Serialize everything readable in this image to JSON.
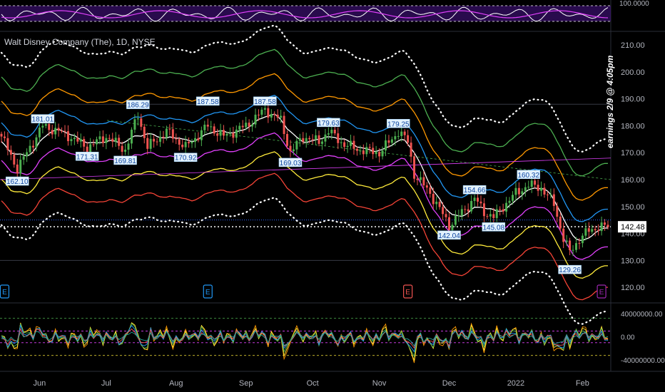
{
  "header": {
    "title": "Walt Disney Company (The), 1D, NYSE",
    "side_note": "earnings 2/9 @ 4:05pm"
  },
  "colors": {
    "background": "#000000",
    "up": "#26a69a",
    "up_bright": "#4caf50",
    "down": "#ef5350",
    "grid": "#1a1a1a",
    "band_white": "#ffffff",
    "band_blue": "#2196f3",
    "band_orange": "#ff9800",
    "band_green": "#4caf50",
    "band_magenta": "#e040fb",
    "band_yellow": "#ffeb3b",
    "band_red": "#f44336",
    "rsi_purple": "#9c27b0",
    "last_price_bg": "#ffffff"
  },
  "top_panel": {
    "axis_label": "100.0000"
  },
  "chart_data": {
    "type": "candlestick",
    "price_axis": {
      "ticks": [
        "210.00",
        "200.00",
        "190.00",
        "180.00",
        "170.00",
        "160.00",
        "150.00",
        "140.00",
        "130.00",
        "120.00"
      ],
      "tick_values": [
        210,
        200,
        190,
        180,
        170,
        160,
        150,
        140,
        130,
        120
      ],
      "range": [
        115,
        214
      ]
    },
    "x_axis": {
      "labels": [
        "Jun",
        "Jul",
        "Aug",
        "Sep",
        "Oct",
        "Nov",
        "Dec",
        "2022",
        "Feb"
      ],
      "label_bars": [
        12,
        33,
        55,
        77,
        98,
        119,
        141,
        162,
        183
      ]
    },
    "last_price": "142.48",
    "last_price_value": 142.48,
    "price_labels": [
      {
        "text": "162.10",
        "bar": 5,
        "value": 162.1,
        "pos": "below"
      },
      {
        "text": "181.01",
        "bar": 13,
        "value": 181.01,
        "pos": "above"
      },
      {
        "text": "171.31",
        "bar": 27,
        "value": 171.31,
        "pos": "below"
      },
      {
        "text": "169.81",
        "bar": 39,
        "value": 169.81,
        "pos": "below"
      },
      {
        "text": "186.29",
        "bar": 43,
        "value": 186.29,
        "pos": "above"
      },
      {
        "text": "187.58",
        "bar": 65,
        "value": 187.58,
        "pos": "above"
      },
      {
        "text": "170.92",
        "bar": 58,
        "value": 170.92,
        "pos": "below"
      },
      {
        "text": "187.58",
        "bar": 83,
        "value": 187.58,
        "pos": "above"
      },
      {
        "text": "169.03",
        "bar": 91,
        "value": 169.03,
        "pos": "below"
      },
      {
        "text": "179.63",
        "bar": 103,
        "value": 179.63,
        "pos": "above"
      },
      {
        "text": "179.25",
        "bar": 125,
        "value": 179.25,
        "pos": "above"
      },
      {
        "text": "142.04",
        "bar": 141,
        "value": 142.04,
        "pos": "below"
      },
      {
        "text": "154.66",
        "bar": 149,
        "value": 154.66,
        "pos": "above"
      },
      {
        "text": "145.08",
        "bar": 155,
        "value": 145.08,
        "pos": "below"
      },
      {
        "text": "160.32",
        "bar": 166,
        "value": 160.32,
        "pos": "above"
      },
      {
        "text": "129.26",
        "bar": 179,
        "value": 129.26,
        "pos": "below"
      }
    ],
    "earnings_markers": [
      {
        "label": "E",
        "bar": 1,
        "color": "#2196f3"
      },
      {
        "label": "E",
        "bar": 65,
        "color": "#2196f3"
      },
      {
        "label": "E",
        "bar": 128,
        "color": "#ef5350"
      },
      {
        "label": "E",
        "bar": 189,
        "color": "#9c27b0"
      }
    ],
    "key_closes": [
      [
        0,
        176
      ],
      [
        5,
        164
      ],
      [
        13,
        180
      ],
      [
        20,
        177
      ],
      [
        27,
        172
      ],
      [
        33,
        176
      ],
      [
        39,
        171
      ],
      [
        43,
        184
      ],
      [
        46,
        172
      ],
      [
        52,
        178
      ],
      [
        58,
        172
      ],
      [
        65,
        180
      ],
      [
        70,
        176
      ],
      [
        77,
        180
      ],
      [
        83,
        186
      ],
      [
        88,
        182
      ],
      [
        91,
        170
      ],
      [
        95,
        176
      ],
      [
        100,
        174
      ],
      [
        103,
        178
      ],
      [
        108,
        173
      ],
      [
        113,
        171
      ],
      [
        119,
        170
      ],
      [
        123,
        175
      ],
      [
        125,
        178
      ],
      [
        128,
        174
      ],
      [
        130,
        162
      ],
      [
        135,
        155
      ],
      [
        141,
        143
      ],
      [
        146,
        149
      ],
      [
        149,
        153
      ],
      [
        152,
        148
      ],
      [
        155,
        146
      ],
      [
        158,
        150
      ],
      [
        162,
        155
      ],
      [
        166,
        158
      ],
      [
        170,
        157
      ],
      [
        174,
        151
      ],
      [
        177,
        138
      ],
      [
        179,
        133
      ],
      [
        182,
        138
      ],
      [
        185,
        141
      ],
      [
        188,
        142.48
      ]
    ],
    "osc_axis": {
      "ticks": [
        "40000000.00",
        "0.00",
        "-40000000.00"
      ],
      "tick_values": [
        40000000,
        0,
        -40000000
      ]
    }
  }
}
